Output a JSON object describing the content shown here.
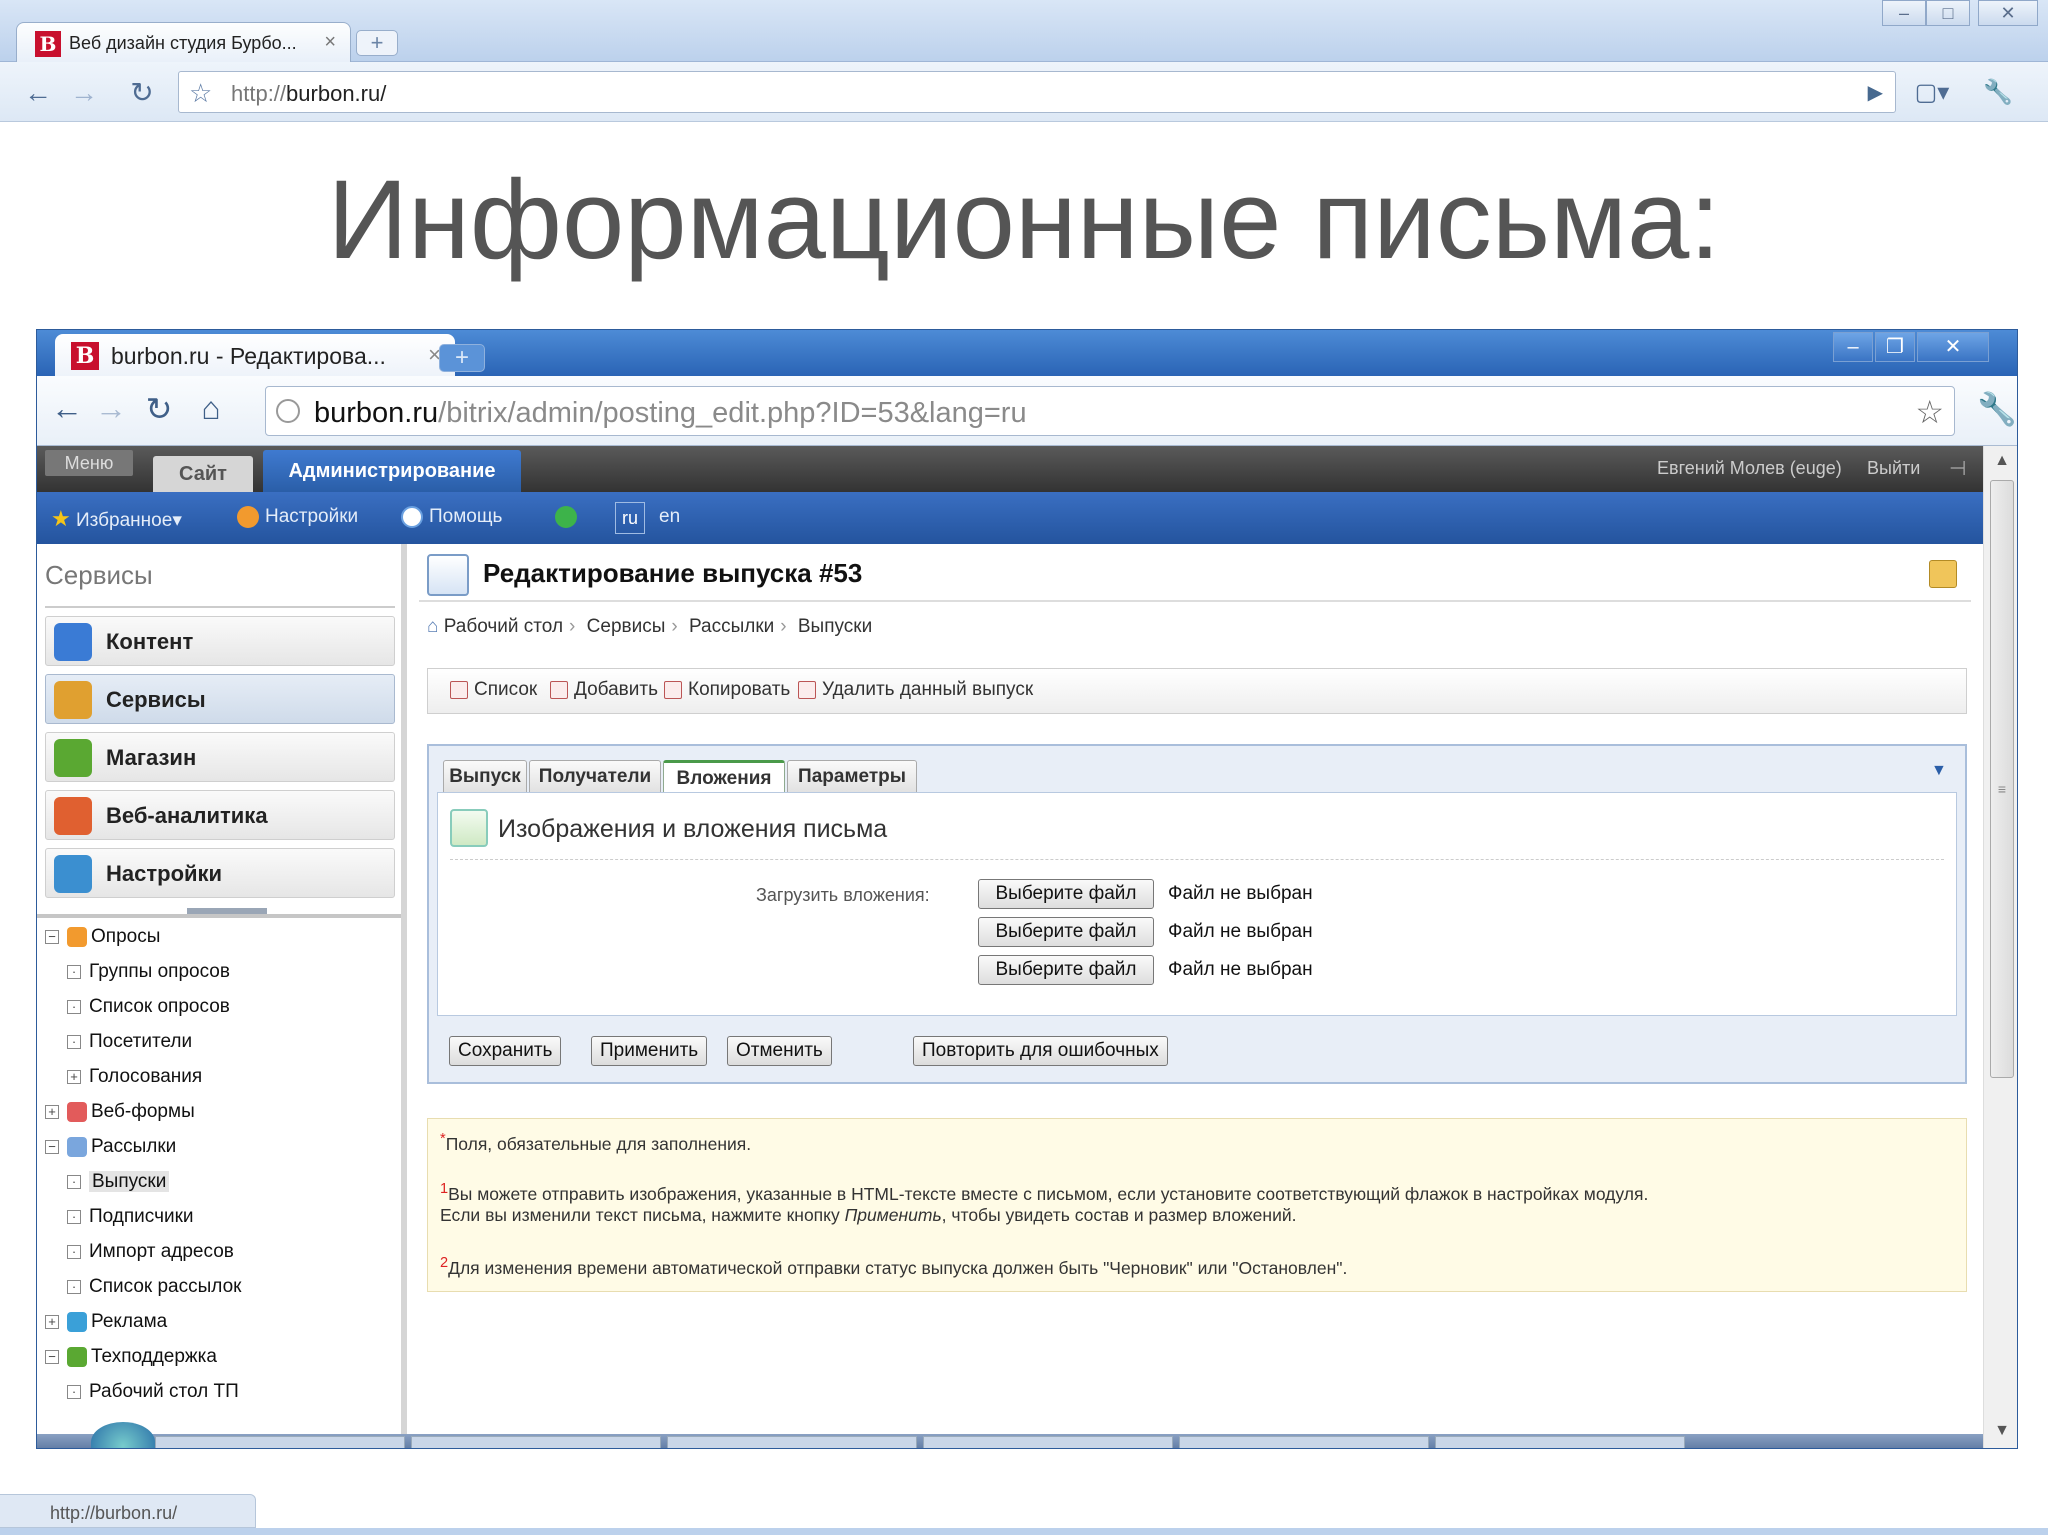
{
  "outer_browser": {
    "tab_title": "Веб дизайн студия Бурбо...",
    "url_prefix": "http://",
    "url_host": "burbon.ru/"
  },
  "slide_title": "Информационные письма:",
  "inner_browser": {
    "tab_title": "burbon.ru - Редактирова...",
    "url_host": "burbon.ru",
    "url_path": "/bitrix/admin/posting_edit.php?ID=53&lang=ru"
  },
  "admin": {
    "menu_label": "Меню",
    "tabs": [
      "Сайт",
      "Администрирование"
    ],
    "user": "Евгений Молев (euge)",
    "logout": "Выйти",
    "bar": {
      "favorites": "Избранное",
      "settings": "Настройки",
      "help": "Помощь",
      "lang_ru": "ru",
      "lang_en": "en"
    }
  },
  "sidebar": {
    "title": "Сервисы",
    "buttons": [
      {
        "label": "Контент",
        "color": "#3a7bd5"
      },
      {
        "label": "Сервисы",
        "color": "#e0a030"
      },
      {
        "label": "Магазин",
        "color": "#5aa832"
      },
      {
        "label": "Веб-аналитика",
        "color": "#e06030"
      },
      {
        "label": "Настройки",
        "color": "#3b8fd0"
      }
    ],
    "tree": [
      {
        "label": "Опросы",
        "box": "−",
        "level": 0,
        "icon": true
      },
      {
        "label": "Группы опросов",
        "box": "·",
        "level": 1
      },
      {
        "label": "Список опросов",
        "box": "·",
        "level": 1
      },
      {
        "label": "Посетители",
        "box": "·",
        "level": 1
      },
      {
        "label": "Голосования",
        "box": "+",
        "level": 1
      },
      {
        "label": "Веб-формы",
        "box": "+",
        "level": 0,
        "icon": true
      },
      {
        "label": "Рассылки",
        "box": "−",
        "level": 0,
        "icon": true
      },
      {
        "label": "Выпуски",
        "box": "·",
        "level": 1,
        "current": true
      },
      {
        "label": "Подписчики",
        "box": "·",
        "level": 1
      },
      {
        "label": "Импорт адресов",
        "box": "·",
        "level": 1
      },
      {
        "label": "Список рассылок",
        "box": "·",
        "level": 1
      },
      {
        "label": "Реклама",
        "box": "+",
        "level": 0,
        "icon": true
      },
      {
        "label": "Техподдержка",
        "box": "−",
        "level": 0,
        "icon": true
      },
      {
        "label": "Рабочий стол ТП",
        "box": "·",
        "level": 1
      }
    ]
  },
  "main": {
    "title": "Редактирование выпуска #53",
    "breadcrumb": [
      "Рабочий стол",
      "Сервисы",
      "Рассылки",
      "Выпуски"
    ],
    "context_menu": [
      "Список",
      "Добавить",
      "Копировать",
      "Удалить данный выпуск"
    ],
    "form_tabs": [
      "Выпуск",
      "Получатели",
      "Вложения",
      "Параметры"
    ],
    "active_tab": "Вложения",
    "section_title": "Изображения и вложения письма",
    "upload_label": "Загрузить вложения:",
    "file_button": "Выберите файл",
    "file_status": "Файл не выбран",
    "buttons": [
      "Сохранить",
      "Применить",
      "Отменить",
      "Повторить для ошибочных"
    ],
    "notes": {
      "required": "Поля, обязательные для заполнения.",
      "note1_line1": "Вы можете отправить изображения, указанные в HTML-тексте вместе с письмом, если установите соответствующий флажок в настройках модуля.",
      "note1_line2_a": "Если вы изменили текст письма, нажмите кнопку ",
      "note1_line2_em": "Применить",
      "note1_line2_b": ", чтобы увидеть состав и размер вложений.",
      "note2": "Для изменения времени автоматической отправки статус выпуска должен быть \"Черновик\" или \"Остановлен\"."
    }
  },
  "status_bar": "http://burbon.ru/"
}
